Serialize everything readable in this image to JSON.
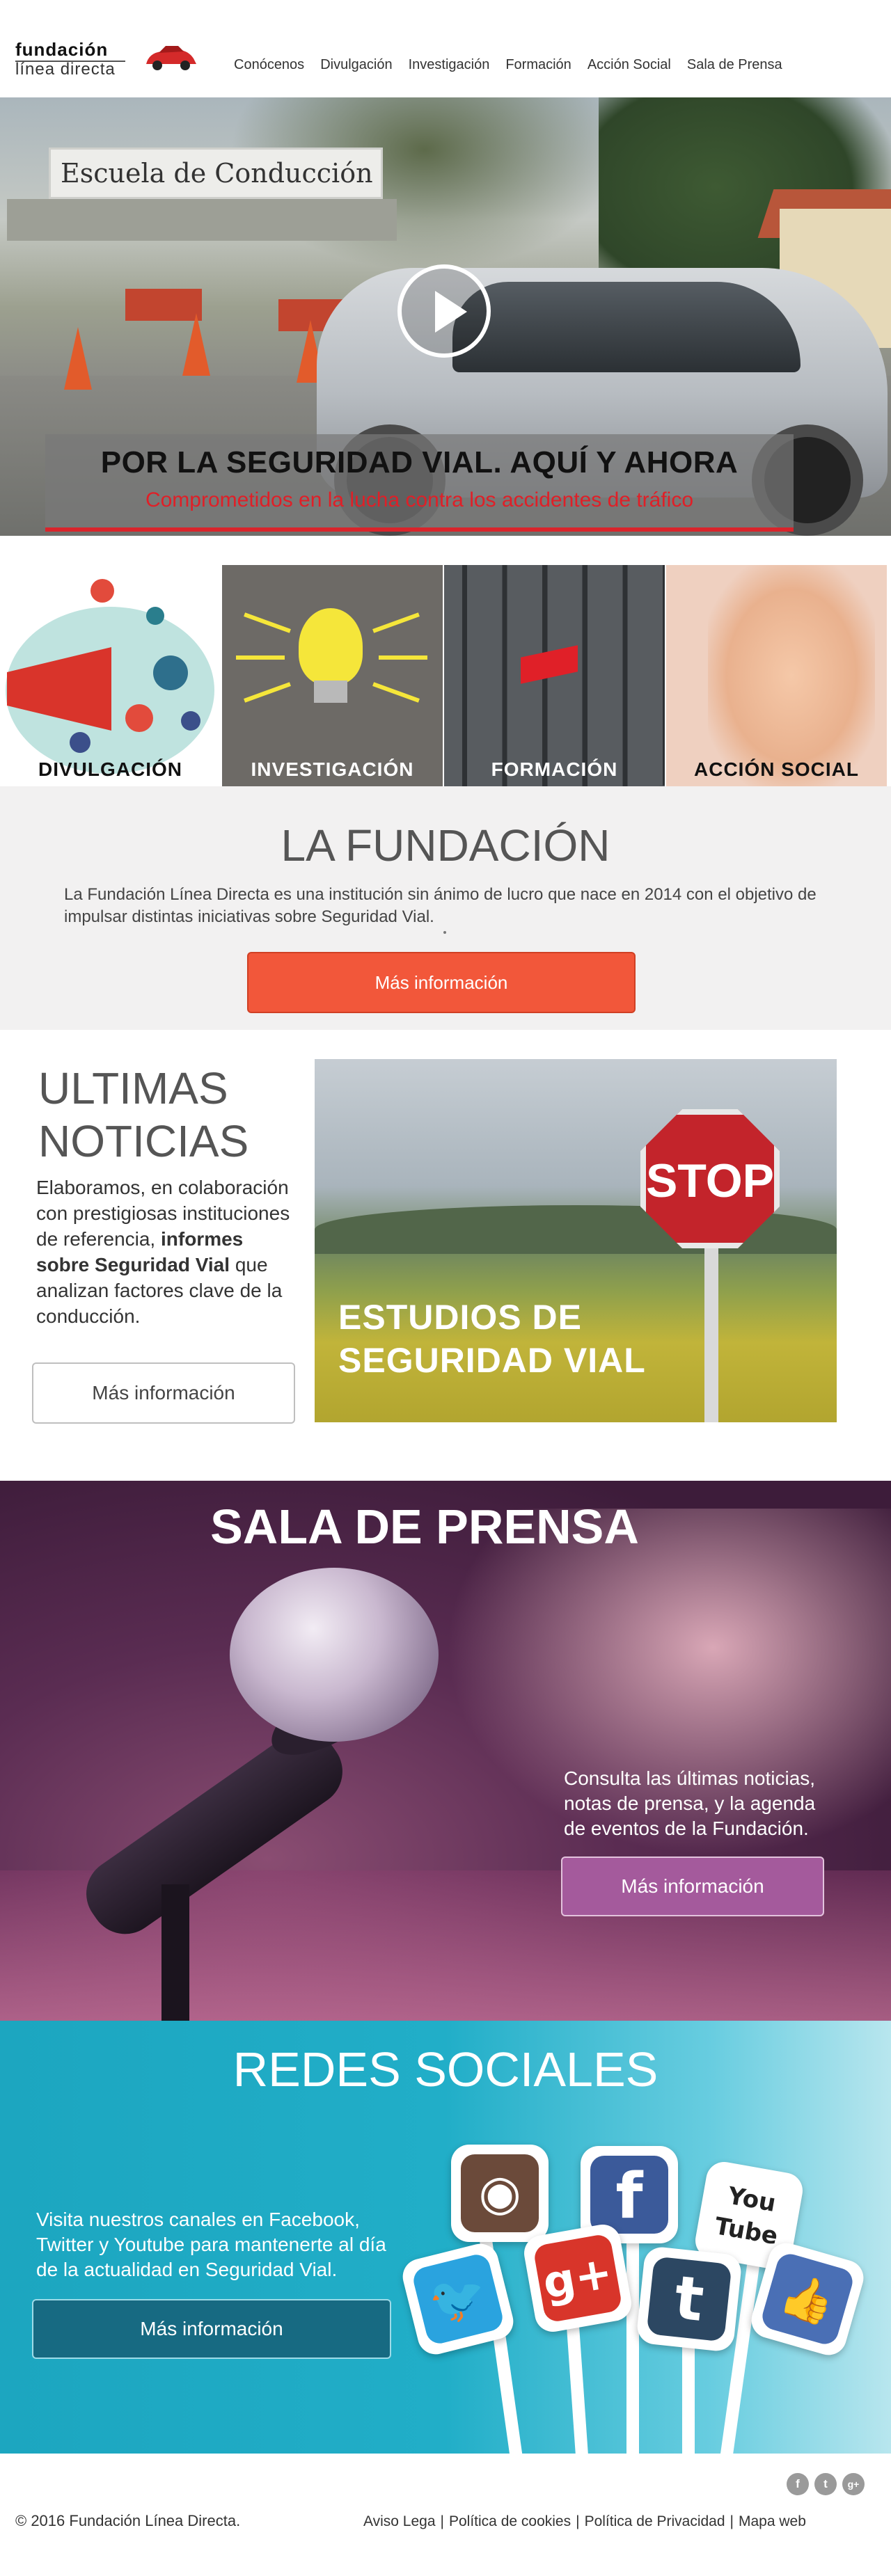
{
  "header": {
    "logo_line1": "fundación",
    "logo_line2": "línea directa",
    "nav": [
      "Conócenos",
      "Divulgación",
      "Investigación",
      "Formación",
      "Acción Social",
      "Sala de Prensa"
    ]
  },
  "hero": {
    "sign_text": "Escuela de Conducción",
    "title": "POR LA SEGURIDAD VIAL. AQUÍ Y AHORA",
    "subtitle": "Comprometidos en la lucha contra los accidentes de tráfico",
    "play_icon": "play-icon"
  },
  "tiles": [
    {
      "label": "DIVULGACIÓN",
      "icon": "megaphone-icon",
      "color": "#111111"
    },
    {
      "label": "INVESTIGACIÓN",
      "icon": "lightbulb-icon",
      "color": "#ffffff"
    },
    {
      "label": "FORMACIÓN",
      "icon": "keyboard-icon",
      "color": "#ffffff"
    },
    {
      "label": "ACCIÓN SOCIAL",
      "icon": "hands-icon",
      "color": "#111111"
    }
  ],
  "fundacion": {
    "title": "LA FUNDACIÓN",
    "text": "La Fundación Línea Directa es una institución sin ánimo de lucro que nace en 2014 con el objetivo de impulsar distintas iniciativas sobre Seguridad Vial.",
    "button": "Más información",
    "button_color": "#f2573a"
  },
  "news": {
    "title_line1": "ULTIMAS",
    "title_line2": "NOTICIAS",
    "text_before": "Elaboramos, en colaboración con prestigiosas instituciones de referencia,",
    "text_bold": "informes sobre Seguridad Vial",
    "text_after": "que analizan factores clave de la conducción.",
    "button": "Más información",
    "image_sign": "STOP",
    "image_caption_line1": "ESTUDIOS DE",
    "image_caption_line2": "SEGURIDAD VIAL"
  },
  "press": {
    "title": "SALA DE PRENSA",
    "text": "Consulta las últimas noticias, notas de prensa, y la agenda de eventos de la Fundación.",
    "button": "Más información",
    "button_color": "#a45a9c"
  },
  "social": {
    "title": "REDES SOCIALES",
    "text": "Visita nuestros canales en Facebook, Twitter y Youtube para mantenerte al día de la actualidad en Seguridad Vial.",
    "button": "Más información",
    "button_color": "#176a82",
    "icons": [
      {
        "name": "instagram-icon",
        "glyph": "◉",
        "color": "#6b4a3a"
      },
      {
        "name": "facebook-icon",
        "glyph": "f",
        "color": "#3b5a9a"
      },
      {
        "name": "youtube-icon",
        "glyph": "You Tube",
        "color": "#d8262b"
      },
      {
        "name": "twitter-icon",
        "glyph": "🐦",
        "color": "#2aa3df"
      },
      {
        "name": "googleplus-icon",
        "glyph": "g+",
        "color": "#d8352a"
      },
      {
        "name": "tumblr-icon",
        "glyph": "t",
        "color": "#2c4762"
      },
      {
        "name": "like-icon",
        "glyph": "👍",
        "color": "#4a6fb5"
      }
    ]
  },
  "footer": {
    "copyright": "© 2016 Fundación Línea Directa.",
    "links": [
      "Aviso Lega",
      "Política de cookies",
      "Política de Privacidad",
      "Mapa web"
    ],
    "icons": [
      {
        "name": "facebook-icon",
        "glyph": "f"
      },
      {
        "name": "twitter-icon",
        "glyph": "t"
      },
      {
        "name": "googleplus-icon",
        "glyph": "g+"
      }
    ]
  }
}
